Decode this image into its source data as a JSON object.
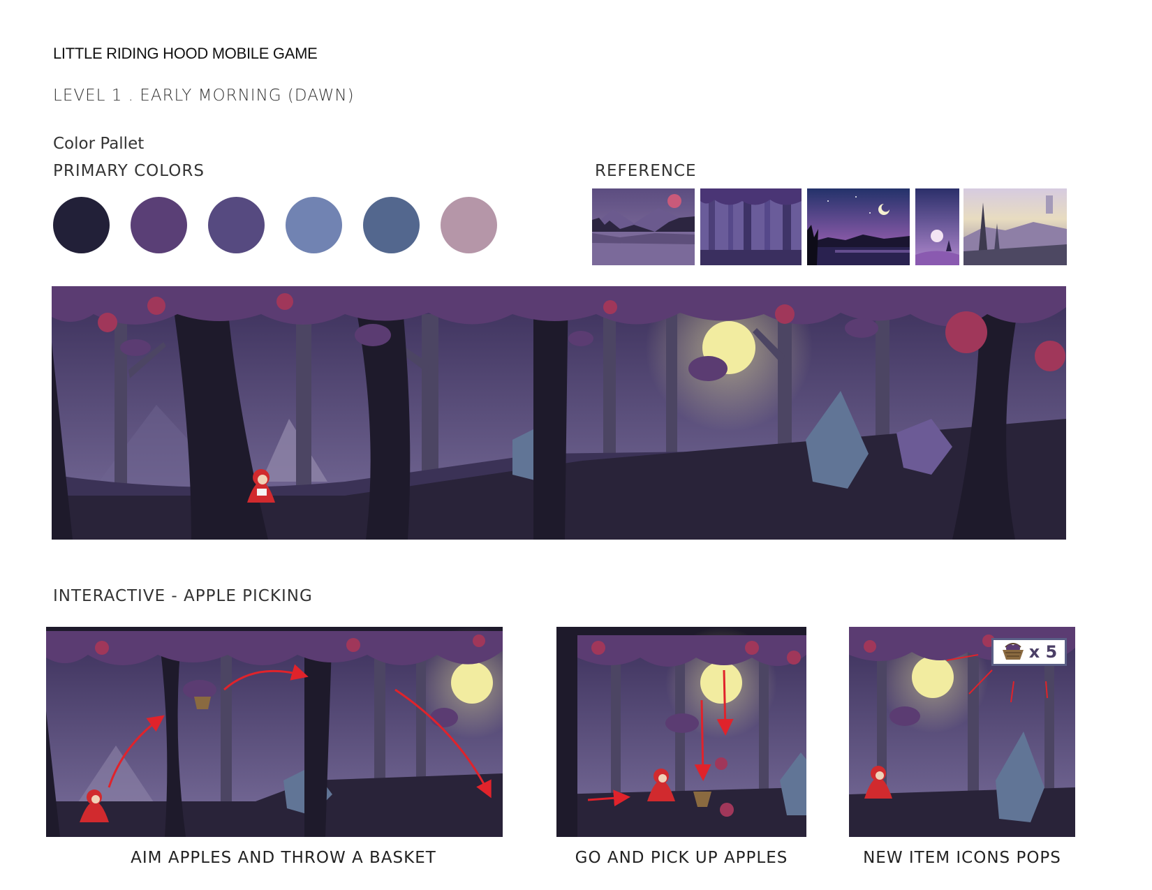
{
  "header": {
    "doc_title": "LITTLE RIDING HOOD MOBILE GAME",
    "level_title": "LEVEL 1 . EARLY MORNING (DAWN)"
  },
  "palette": {
    "section_title": "Color Pallet",
    "subtitle": "PRIMARY COLORS",
    "colors": [
      "#222038",
      "#5a3f76",
      "#564a80",
      "#7183b2",
      "#53678e",
      "#b596a8"
    ]
  },
  "reference": {
    "title": "REFERENCE",
    "images": [
      "lake-mountains-image",
      "purple-forest-image",
      "night-moon-lake-image",
      "moon-tree-image",
      "misty-forest-image"
    ]
  },
  "scene": {
    "name": "forest-level-scene",
    "colors": {
      "sky_top": "#3b2f5a",
      "sky_bottom": "#7a6f9c",
      "canopy": "#5b3c72",
      "apple": "#a0375a",
      "moon": "#f2eca0",
      "ground": "#292339",
      "trunk_front": "#1e1a2b",
      "trunk_back": "#4c4563",
      "rock": "#617596",
      "hood": "#d12a2e",
      "arrow": "#e0232b"
    }
  },
  "interactive": {
    "title": "INTERACTIVE - APPLE PICKING",
    "panels": [
      {
        "caption": "AIM APPLES AND THROW A BASKET"
      },
      {
        "caption": "GO AND PICK UP APPLES"
      },
      {
        "caption": "NEW ITEM ICONS POPS",
        "item_count": "x 5"
      }
    ]
  }
}
